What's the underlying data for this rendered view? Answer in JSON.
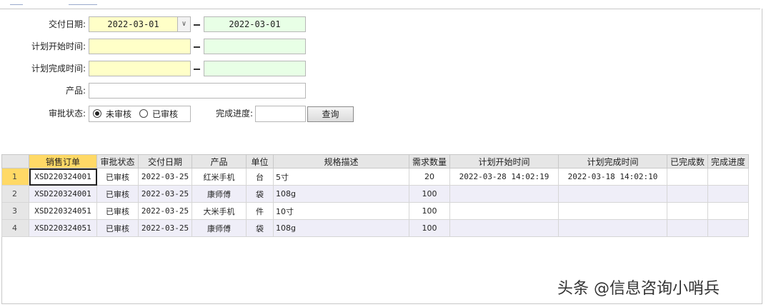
{
  "filters": {
    "delivery_date_label": "交付日期:",
    "delivery_date_from": "2022-03-01",
    "delivery_date_to": "2022-03-01",
    "plan_start_label": "计划开始时间:",
    "plan_end_label": "计划完成时间:",
    "product_label": "产品:",
    "approval_label": "审批状态:",
    "approval_options": [
      "未审核",
      "已审核"
    ],
    "progress_label": "完成进度:",
    "query_button": "查询"
  },
  "table": {
    "columns": [
      "销售订单",
      "审批状态",
      "交付日期",
      "产品",
      "单位",
      "规格描述",
      "需求数量",
      "计划开始时间",
      "计划完成时间",
      "已完成数",
      "完成进度"
    ],
    "rows": [
      {
        "num": "1",
        "order": "XSD220324001",
        "status": "已审核",
        "date": "2022-03-25",
        "product": "红米手机",
        "unit": "台",
        "spec": "5寸",
        "qty": "20",
        "start": "2022-03-28 14:02:19",
        "end": "2022-03-18 14:02:10",
        "done": "",
        "progress": ""
      },
      {
        "num": "2",
        "order": "XSD220324001",
        "status": "已审核",
        "date": "2022-03-25",
        "product": "康师傅",
        "unit": "袋",
        "spec": "108g",
        "qty": "100",
        "start": "",
        "end": "",
        "done": "",
        "progress": ""
      },
      {
        "num": "3",
        "order": "XSD220324051",
        "status": "已审核",
        "date": "2022-03-25",
        "product": "大米手机",
        "unit": "件",
        "spec": "10寸",
        "qty": "100",
        "start": "",
        "end": "",
        "done": "",
        "progress": ""
      },
      {
        "num": "4",
        "order": "XSD220324051",
        "status": "已审核",
        "date": "2022-03-25",
        "product": "康师傅",
        "unit": "袋",
        "spec": "108g",
        "qty": "100",
        "start": "",
        "end": "",
        "done": "",
        "progress": ""
      }
    ]
  },
  "watermark": "头条 @信息咨询小哨兵"
}
